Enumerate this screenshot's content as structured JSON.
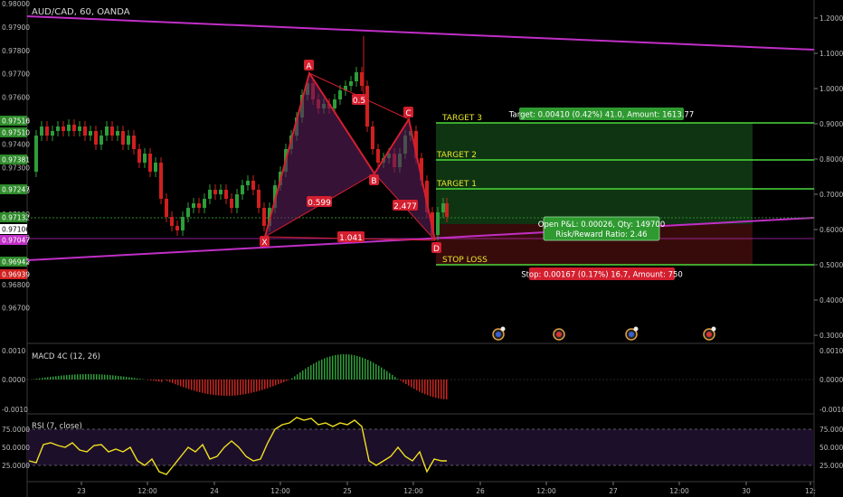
{
  "title": "AUD/CAD, 60, OANDA",
  "colors": {
    "background": "#000000",
    "up": "#2e9e3a",
    "down": "#d0201f",
    "trendline": "#c02fc6",
    "pattern_line": "#d41f2f",
    "target_line": "#4cd93a",
    "rsi_line": "#f0e020"
  },
  "left_axis_labels": [
    "0.98000",
    "0.97900",
    "0.97800",
    "0.97700",
    "0.97600",
    "0.97500",
    "0.97400",
    "0.97300",
    "0.97200",
    "0.97100",
    "0.97000",
    "0.96900",
    "0.96800",
    "0.96700"
  ],
  "left_axis_badges": [
    {
      "text": "0.97516",
      "color": "#2e8a2a"
    },
    {
      "text": "0.97510",
      "color": "#2e8a2a"
    },
    {
      "text": "0.97381",
      "color": "#2e8a2a"
    },
    {
      "text": "0.97247",
      "color": "#2e8a2a"
    },
    {
      "text": "0.97132",
      "color": "#2e8a2a"
    },
    {
      "text": "0.97106",
      "color": "#ffffff"
    },
    {
      "text": "0.97047",
      "color": "#c02fc6"
    },
    {
      "text": "0.96942",
      "color": "#2e8a2a"
    },
    {
      "text": "0.96939",
      "color": "#d0201f"
    }
  ],
  "right_axis_labels": [
    "1.2000",
    "1.1000",
    "1.0000",
    "0.9000",
    "0.8000",
    "0.7000",
    "0.6000",
    "0.5000",
    "0.4000",
    "0.3000"
  ],
  "pattern_points": {
    "X": "X",
    "A": "A",
    "B": "B",
    "C": "C",
    "D": "D"
  },
  "pattern_ratios": {
    "xb": "0.599",
    "ac": "0.5",
    "bd": "2.477",
    "xd": "1.041"
  },
  "targets": {
    "t3": "TARGET 3",
    "t2": "TARGET 2",
    "t1": "TARGET 1",
    "stop": "STOP LOSS"
  },
  "target_info": "Target: 0.00410 (0.42%) 41.0, Amount: 1613.77",
  "position_info": [
    "Open P&L: 0.00026, Qty: 149700",
    "Risk/Reward Ratio: 2.46"
  ],
  "stop_info": "Stop: 0.00167 (0.17%) 16.7, Amount: 750",
  "macd": {
    "label": "MACD 4C (12, 26)",
    "axis": [
      "0.0010",
      "0.0000",
      "-0.0010"
    ],
    "right_axis": [
      "0.0010",
      "0.0000",
      "-0.0010"
    ]
  },
  "rsi": {
    "label": "RSI (7, close)",
    "axis": [
      "75.0000",
      "50.0000",
      "25.0000"
    ],
    "right_axis": [
      "75.0000",
      "50.0000",
      "25.0000"
    ]
  },
  "time_labels": [
    "23",
    "12:00",
    "24",
    "12:00",
    "25",
    "12:00",
    "26",
    "12:00",
    "27",
    "12:00",
    "30",
    "12:"
  ]
}
